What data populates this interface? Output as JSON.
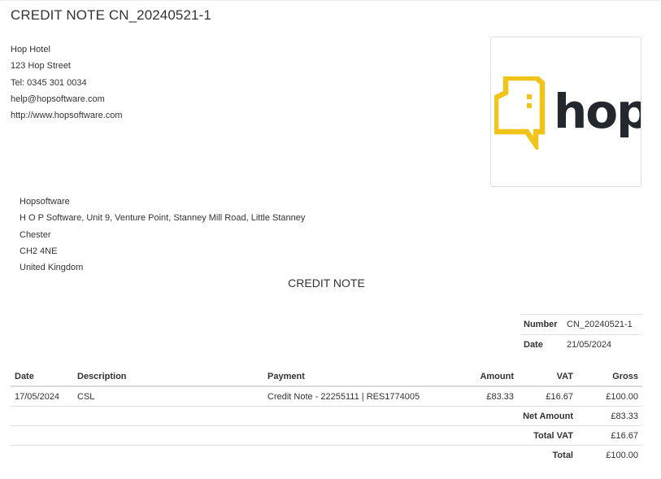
{
  "document": {
    "title": "CREDIT NOTE CN_20240521-1",
    "heading": "CREDIT NOTE"
  },
  "sender": {
    "name": "Hop Hotel",
    "street": "123 Hop Street",
    "tel": "Tel: 0345 301 0034",
    "email": "help@hopsoftware.com",
    "website": "http://www.hopsoftware.com"
  },
  "logo": {
    "text": "hop",
    "icon": "hop-speech-bubble-icon",
    "accent_color": "#f0c419",
    "text_color": "#23272e"
  },
  "recipient": {
    "name": "Hopsoftware",
    "address": "H O P Software, Unit 9, Venture Point, Stanney Mill Road, Little Stanney",
    "city": "Chester",
    "postcode": "CH2 4NE",
    "country": "United Kingdom"
  },
  "meta": {
    "number_label": "Number",
    "number_value": "CN_20240521-1",
    "date_label": "Date",
    "date_value": "21/05/2024"
  },
  "table": {
    "headers": {
      "date": "Date",
      "description": "Description",
      "payment": "Payment",
      "amount": "Amount",
      "vat": "VAT",
      "gross": "Gross"
    },
    "rows": [
      {
        "date": "17/05/2024",
        "description": "CSL",
        "payment": "Credit Note - 22255111 | RES1774005",
        "amount": "£83.33",
        "vat": "£16.67",
        "gross": "£100.00"
      }
    ]
  },
  "totals": {
    "net_label": "Net Amount",
    "net_value": "£83.33",
    "vat_label": "Total VAT",
    "vat_value": "£16.67",
    "total_label": "Total",
    "total_value": "£100.00"
  }
}
